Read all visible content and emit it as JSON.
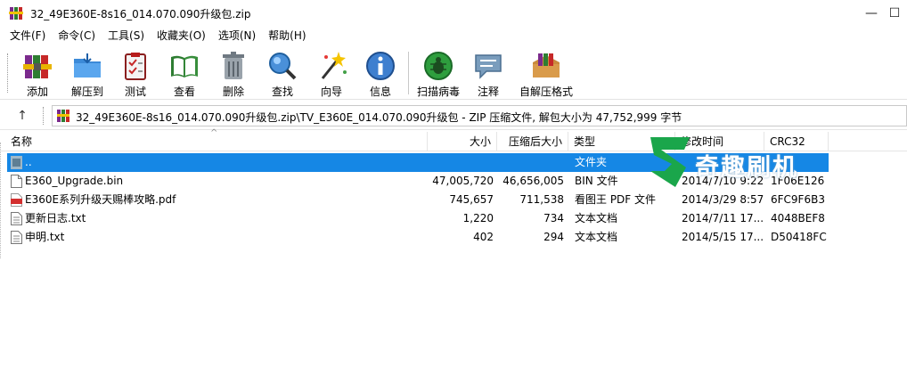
{
  "window": {
    "title": "32_49E360E-8s16_014.070.090升级包.zip",
    "minimize_glyph": "—",
    "maximize_glyph": "☐"
  },
  "menu": [
    "文件(F)",
    "命令(C)",
    "工具(S)",
    "收藏夹(O)",
    "选项(N)",
    "帮助(H)"
  ],
  "toolbar": {
    "add": "添加",
    "extract_to": "解压到",
    "test": "测试",
    "view": "查看",
    "delete": "删除",
    "find": "查找",
    "wizard": "向导",
    "info": "信息",
    "scan_virus": "扫描病毒",
    "comment": "注释",
    "sfx": "自解压格式"
  },
  "address": {
    "up_glyph": "↑",
    "path": "32_49E360E-8s16_014.070.090升级包.zip\\TV_E360E_014.070.090升级包 - ZIP 压缩文件, 解包大小为 47,752,999 字节"
  },
  "columns": {
    "name": "名称",
    "size": "大小",
    "packed": "压缩后大小",
    "type": "类型",
    "modified": "修改时间",
    "crc": "CRC32"
  },
  "rows": [
    {
      "name": "..",
      "size": "",
      "packed": "",
      "type": "文件夹",
      "modified": "",
      "crc": "",
      "icon": "folder-up-icon"
    },
    {
      "name": "E360_Upgrade.bin",
      "size": "47,005,720",
      "packed": "46,656,005",
      "type": "BIN 文件",
      "modified": "2014/7/10 9:22",
      "crc": "1F06E126",
      "icon": "file-icon"
    },
    {
      "name": "E360E系列升级天赐棒攻略.pdf",
      "size": "745,657",
      "packed": "711,538",
      "type": "看图王 PDF 文件",
      "modified": "2014/3/29 8:57",
      "crc": "6FC9F6B3",
      "icon": "pdf-file-icon"
    },
    {
      "name": "更新日志.txt",
      "size": "1,220",
      "packed": "734",
      "type": "文本文档",
      "modified": "2014/7/11 17...",
      "crc": "4048BEF8",
      "icon": "text-file-icon"
    },
    {
      "name": "申明.txt",
      "size": "402",
      "packed": "294",
      "type": "文本文档",
      "modified": "2014/5/15 17...",
      "crc": "D50418FC",
      "icon": "text-file-icon"
    }
  ],
  "watermark": {
    "text": "奇趣刷机"
  },
  "colors": {
    "selection": "#1587e5",
    "watermark_green": "#1aa64b"
  }
}
